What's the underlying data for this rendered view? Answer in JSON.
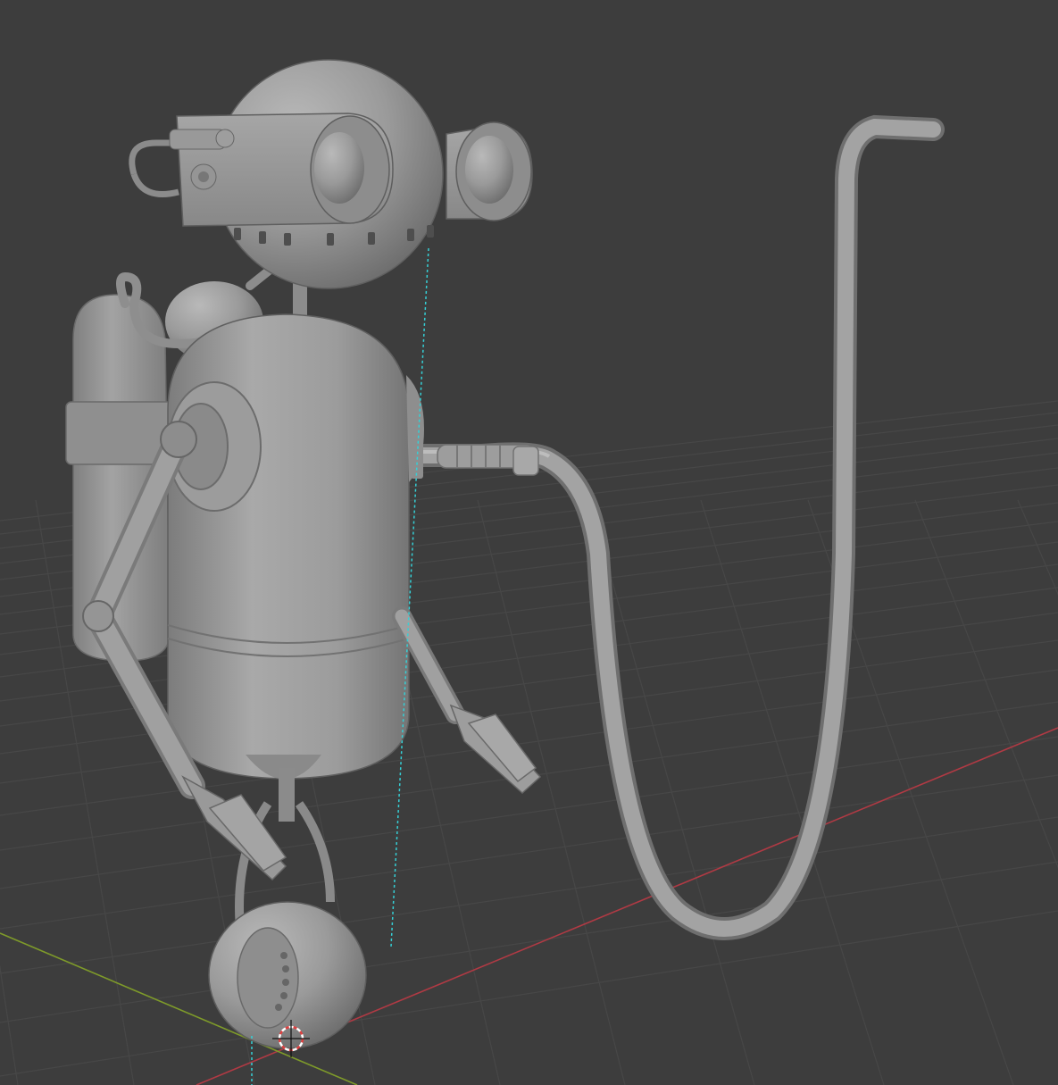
{
  "viewport": {
    "kind": "3d-viewport",
    "shading": "solid",
    "background_color": "#3d3d3d",
    "grid_color": "#4a4a4a",
    "x_axis_color": "#b03a44",
    "y_axis_color": "#7e9a2a",
    "selection_guide_color": "#35d0d6"
  },
  "scene": {
    "objects": [
      {
        "name": "robot-head-icon"
      },
      {
        "name": "robot-goggles-icon"
      },
      {
        "name": "robot-body-icon"
      },
      {
        "name": "gas-tank-icon"
      },
      {
        "name": "robot-arm-left-icon"
      },
      {
        "name": "robot-arm-right-icon"
      },
      {
        "name": "hose-icon"
      },
      {
        "name": "wheel-icon"
      },
      {
        "name": "3d-cursor-icon"
      }
    ]
  }
}
